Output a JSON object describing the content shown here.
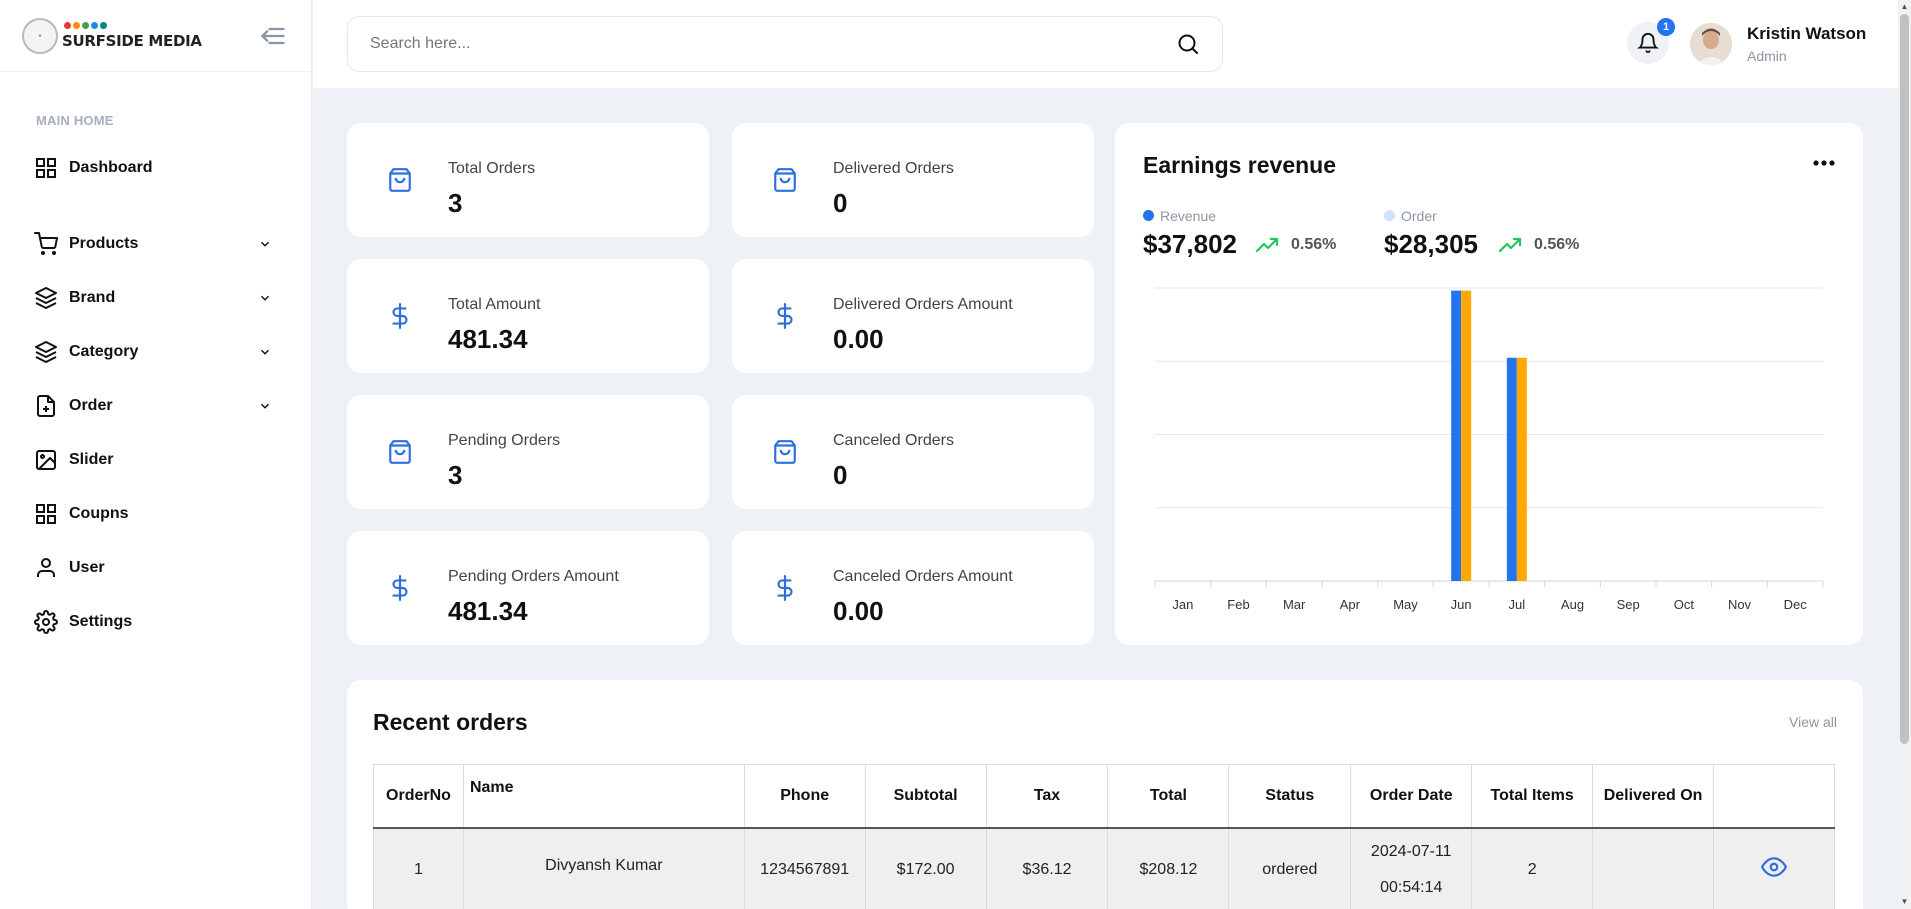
{
  "brand": {
    "name": "SURFSIDE MEDIA",
    "dot_colors": [
      "#e53935",
      "#fb8c00",
      "#43a047",
      "#1e88e5",
      "#00897b"
    ]
  },
  "sidebar": {
    "section_label": "MAIN HOME",
    "items": [
      {
        "label": "Dashboard",
        "icon": "dashboard-grid-icon",
        "has_chevron": false
      },
      {
        "label": "Products",
        "icon": "cart-icon",
        "has_chevron": true
      },
      {
        "label": "Brand",
        "icon": "layers-icon",
        "has_chevron": true
      },
      {
        "label": "Category",
        "icon": "layers-icon",
        "has_chevron": true
      },
      {
        "label": "Order",
        "icon": "file-plus-icon",
        "has_chevron": true
      },
      {
        "label": "Slider",
        "icon": "image-icon",
        "has_chevron": false
      },
      {
        "label": "Coupns",
        "icon": "grid-icon",
        "has_chevron": false
      },
      {
        "label": "User",
        "icon": "user-icon",
        "has_chevron": false
      },
      {
        "label": "Settings",
        "icon": "gear-icon",
        "has_chevron": false
      }
    ]
  },
  "header": {
    "search_placeholder": "Search here...",
    "notification_count": "1",
    "user_name": "Kristin Watson",
    "user_role": "Admin"
  },
  "stats": [
    {
      "title": "Total Orders",
      "value": "3",
      "icon": "shopping-bag-icon"
    },
    {
      "title": "Delivered Orders",
      "value": "0",
      "icon": "shopping-bag-icon"
    },
    {
      "title": "Total Amount",
      "value": "481.34",
      "icon": "dollar-icon"
    },
    {
      "title": "Delivered Orders Amount",
      "value": "0.00",
      "icon": "dollar-icon"
    },
    {
      "title": "Pending Orders",
      "value": "3",
      "icon": "shopping-bag-icon"
    },
    {
      "title": "Canceled Orders",
      "value": "0",
      "icon": "shopping-bag-icon"
    },
    {
      "title": "Pending Orders Amount",
      "value": "481.34",
      "icon": "dollar-icon"
    },
    {
      "title": "Canceled Orders Amount",
      "value": "0.00",
      "icon": "dollar-icon"
    }
  ],
  "earnings": {
    "title": "Earnings revenue",
    "legend": [
      {
        "name": "Revenue",
        "value": "$37,802",
        "change": "0.56%",
        "color": "#2274f0"
      },
      {
        "name": "Order",
        "value": "$28,305",
        "change": "0.56%",
        "color": "#cfe2fb"
      }
    ]
  },
  "chart_data": {
    "type": "bar",
    "categories": [
      "Jan",
      "Feb",
      "Mar",
      "Apr",
      "May",
      "Jun",
      "Jul",
      "Aug",
      "Sep",
      "Oct",
      "Nov",
      "Dec"
    ],
    "series": [
      {
        "values": [
          0,
          0,
          0,
          0,
          0,
          208.12,
          160,
          0,
          0,
          0,
          0,
          0
        ],
        "color": "#2274f0"
      },
      {
        "values": [
          0,
          0,
          0,
          0,
          0,
          208.12,
          160,
          0,
          0,
          0,
          0,
          0
        ],
        "color": "#ffa800"
      }
    ],
    "ylim": [
      0,
      210
    ],
    "grid": true,
    "title": "",
    "xlabel": "",
    "ylabel": ""
  },
  "orders": {
    "title": "Recent orders",
    "view_all": "View all",
    "columns": [
      "OrderNo",
      "Name",
      "Phone",
      "Subtotal",
      "Tax",
      "Total",
      "Status",
      "Order Date",
      "Total Items",
      "Delivered On",
      ""
    ],
    "rows": [
      {
        "order_no": "1",
        "name": "Divyansh Kumar",
        "phone": "1234567891",
        "subtotal": "$172.00",
        "tax": "$36.12",
        "total": "$208.12",
        "status": "ordered",
        "date": "2024-07-11",
        "time": "00:54:14",
        "items": "2",
        "delivered_on": ""
      }
    ]
  }
}
